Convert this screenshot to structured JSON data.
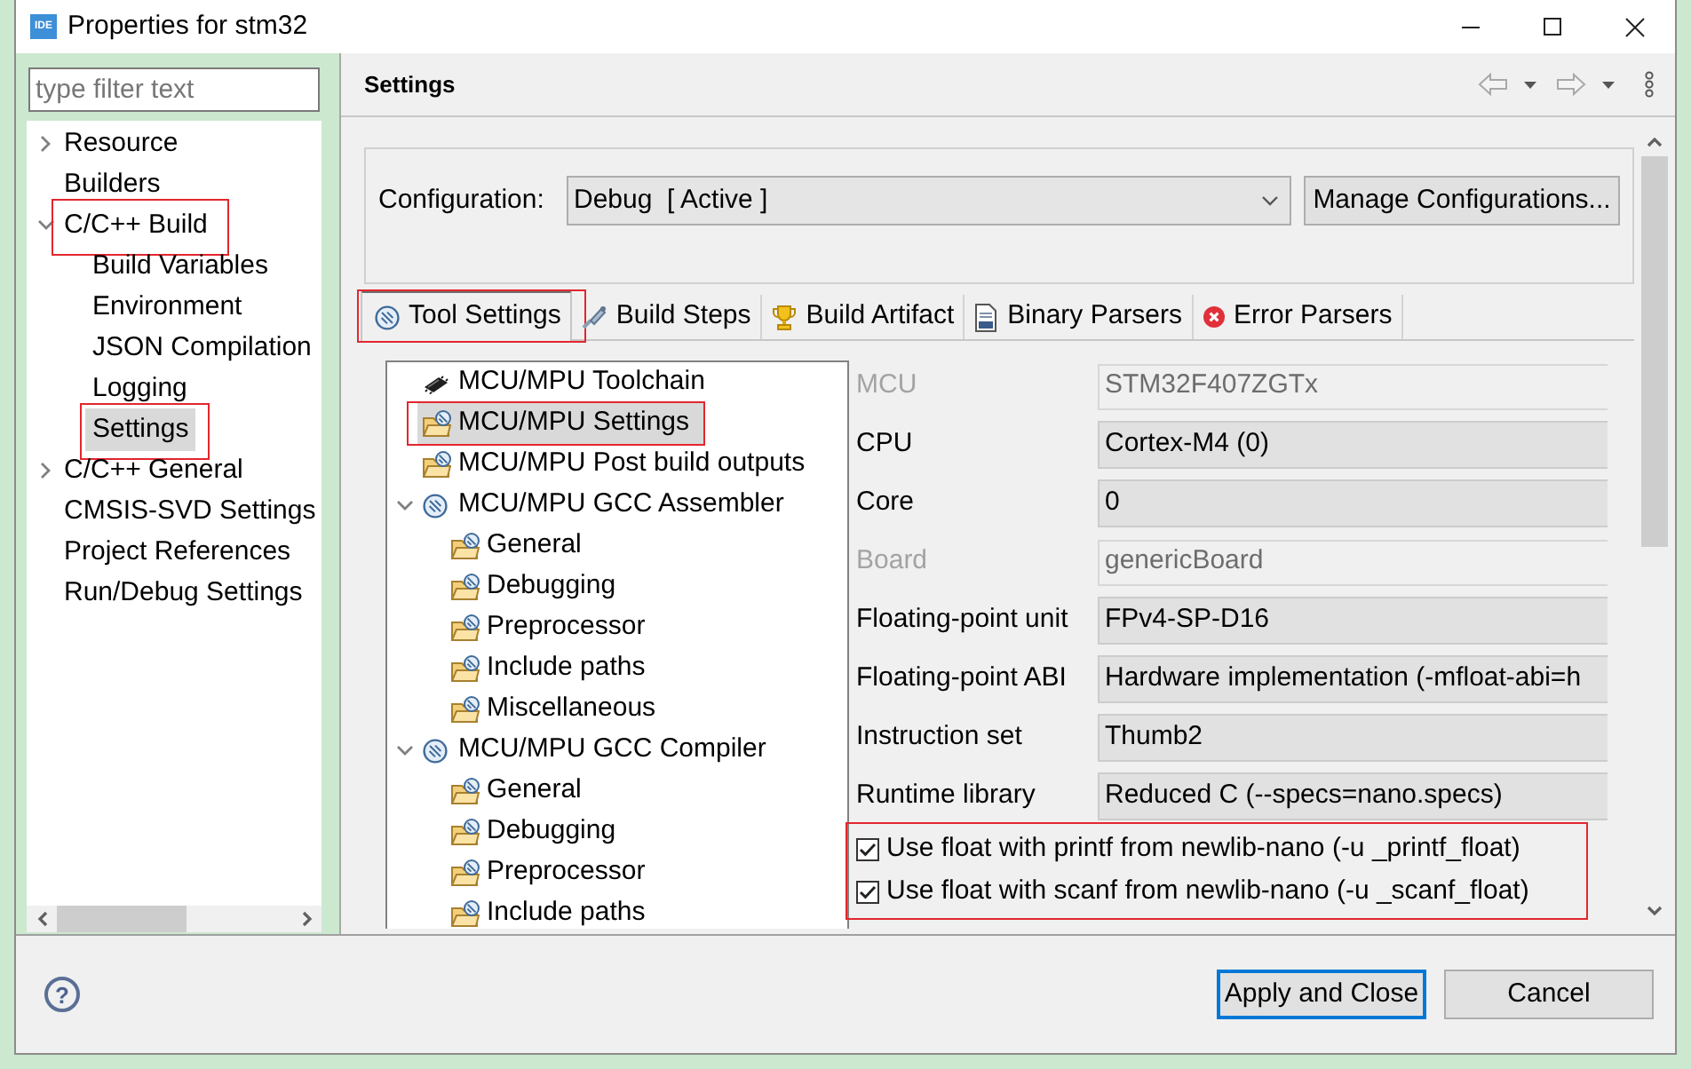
{
  "window": {
    "icon_label": "IDE",
    "title": "Properties for stm32"
  },
  "filter": {
    "placeholder": "type filter text"
  },
  "nav_tree": [
    {
      "label": "Resource",
      "expanded": false,
      "selected": false,
      "annotated": false
    },
    {
      "label": "Builders",
      "selected": false,
      "annotated": false
    },
    {
      "label": "C/C++ Build",
      "expanded": true,
      "selected": false,
      "annotated": true,
      "children": [
        {
          "label": "Build Variables",
          "selected": false,
          "annotated": false
        },
        {
          "label": "Environment",
          "selected": false,
          "annotated": false
        },
        {
          "label": "JSON Compilation",
          "selected": false,
          "annotated": false
        },
        {
          "label": "Logging",
          "selected": false,
          "annotated": false
        },
        {
          "label": "Settings",
          "selected": true,
          "annotated": true
        }
      ]
    },
    {
      "label": "C/C++ General",
      "expanded": false,
      "selected": false,
      "annotated": false
    },
    {
      "label": "CMSIS-SVD Settings",
      "selected": false,
      "annotated": false
    },
    {
      "label": "Project References",
      "selected": false,
      "annotated": false
    },
    {
      "label": "Run/Debug Settings",
      "selected": false,
      "annotated": false
    }
  ],
  "page": {
    "title": "Settings"
  },
  "configuration": {
    "label": "Configuration:",
    "value": "Debug  [ Active ]",
    "button": "Manage Configurations..."
  },
  "tabs": [
    {
      "label": "Tool Settings",
      "selected": true,
      "annotated": true
    },
    {
      "label": "Build Steps",
      "selected": false,
      "annotated": false
    },
    {
      "label": "Build Artifact",
      "selected": false,
      "annotated": false
    },
    {
      "label": "Binary Parsers",
      "selected": false,
      "annotated": false
    },
    {
      "label": "Error Parsers",
      "selected": false,
      "annotated": false
    }
  ],
  "tool_tree": [
    {
      "label": "MCU/MPU Toolchain",
      "kind": "toolchain",
      "selected": false,
      "annotated": false
    },
    {
      "label": "MCU/MPU Settings",
      "kind": "page",
      "selected": true,
      "annotated": true
    },
    {
      "label": "MCU/MPU Post build outputs",
      "kind": "page",
      "selected": false,
      "annotated": false
    },
    {
      "label": "MCU/MPU GCC Assembler",
      "kind": "tool",
      "expanded": true,
      "selected": false,
      "annotated": false,
      "children": [
        {
          "label": "General",
          "kind": "page",
          "selected": false,
          "annotated": false
        },
        {
          "label": "Debugging",
          "kind": "page",
          "selected": false,
          "annotated": false
        },
        {
          "label": "Preprocessor",
          "kind": "page",
          "selected": false,
          "annotated": false
        },
        {
          "label": "Include paths",
          "kind": "page",
          "selected": false,
          "annotated": false
        },
        {
          "label": "Miscellaneous",
          "kind": "page",
          "selected": false,
          "annotated": false
        }
      ]
    },
    {
      "label": "MCU/MPU GCC Compiler",
      "kind": "tool",
      "expanded": true,
      "selected": false,
      "annotated": false,
      "children": [
        {
          "label": "General",
          "kind": "page",
          "selected": false,
          "annotated": false
        },
        {
          "label": "Debugging",
          "kind": "page",
          "selected": false,
          "annotated": false
        },
        {
          "label": "Preprocessor",
          "kind": "page",
          "selected": false,
          "annotated": false
        },
        {
          "label": "Include paths",
          "kind": "page",
          "selected": false,
          "annotated": false
        }
      ]
    }
  ],
  "settings": [
    {
      "label": "MCU",
      "kind": "text",
      "value": "STM32F407ZGTx",
      "disabled": true
    },
    {
      "label": "CPU",
      "kind": "combo",
      "value": "Cortex-M4 (0)",
      "disabled": false
    },
    {
      "label": "Core",
      "kind": "combo",
      "value": "0",
      "disabled": false
    },
    {
      "label": "Board",
      "kind": "text",
      "value": "genericBoard",
      "disabled": true
    },
    {
      "label": "Floating-point unit",
      "kind": "combo",
      "value": "FPv4-SP-D16",
      "disabled": false
    },
    {
      "label": "Floating-point ABI",
      "kind": "combo",
      "value": "Hardware implementation (-mfloat-abi=h",
      "disabled": false
    },
    {
      "label": "Instruction set",
      "kind": "combo",
      "value": "Thumb2",
      "disabled": false
    },
    {
      "label": "Runtime library",
      "kind": "combo",
      "value": "Reduced C (--specs=nano.specs)",
      "disabled": false
    }
  ],
  "options": {
    "annotated": true,
    "items": [
      {
        "label": "Use float with printf from newlib-nano (-u _printf_float)",
        "checked": true
      },
      {
        "label": "Use float with scanf from newlib-nano (-u _scanf_float)",
        "checked": true
      }
    ]
  },
  "help": {
    "label": "?"
  },
  "buttons": [
    {
      "label": "Apply and Close",
      "default": true
    },
    {
      "label": "Cancel",
      "default": false
    }
  ]
}
